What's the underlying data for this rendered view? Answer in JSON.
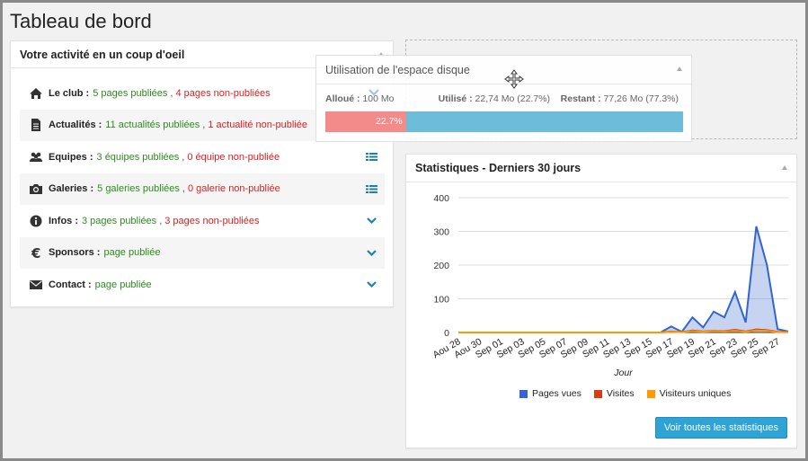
{
  "page": {
    "title": "Tableau de bord"
  },
  "activity": {
    "title": "Votre activité en un coup d'oeil",
    "rows": [
      {
        "icon": "home-icon",
        "label": "Le club :",
        "published": "5 pages publiées",
        "unpublished": "4 pages non-publiées",
        "action": ""
      },
      {
        "icon": "document-icon",
        "label": "Actualités :",
        "published": "11 actualités publiées",
        "unpublished": "1 actualité non-publiée",
        "action": ""
      },
      {
        "icon": "users-icon",
        "label": "Equipes :",
        "published": "3 équipes publiées",
        "unpublished": "0 équipe non-publiée",
        "action": "list-icon"
      },
      {
        "icon": "camera-icon",
        "label": "Galeries :",
        "published": "5 galeries publiées",
        "unpublished": "0 galerie non-publiée",
        "action": "list-icon"
      },
      {
        "icon": "info-icon",
        "label": "Infos :",
        "published": "3 pages publiées",
        "unpublished": "3 pages non-publiées",
        "action": "chevron-down-icon"
      },
      {
        "icon": "euro-icon",
        "label": "Sponsors :",
        "published": "page publiée",
        "unpublished": "",
        "action": "chevron-down-icon"
      },
      {
        "icon": "envelope-icon",
        "label": "Contact :",
        "published": "page publiée",
        "unpublished": "",
        "action": "chevron-down-icon"
      }
    ]
  },
  "disk": {
    "title": "Utilisation de l'espace disque",
    "allocated_label": "Alloué :",
    "allocated_value": "100 Mo",
    "used_label": "Utilisé :",
    "used_value": "22,74 Mo (22.7%)",
    "remaining_label": "Restant :",
    "remaining_value": "77,26 Mo (77.3%)",
    "percent_text": "22.7%",
    "used_fraction": 0.227
  },
  "stats": {
    "title": "Statistiques - Derniers 30 jours",
    "button_label": "Voir toutes les statistiques"
  },
  "colors": {
    "pages_vues": "#3366cc",
    "visites": "#dc3912",
    "visiteurs_uniques": "#ff9900",
    "green": "#2e8b1e",
    "red": "#e02020",
    "action_blue": "#1f7fb8"
  },
  "chart_data": {
    "type": "area",
    "xlabel": "Jour",
    "ylabel": "",
    "ylim": [
      0,
      400
    ],
    "yticks": [
      0,
      100,
      200,
      300,
      400
    ],
    "tick_labels": [
      "Aou 28",
      "Aou 30",
      "Sep 01",
      "Sep 03",
      "Sep 05",
      "Sep 07",
      "Sep 09",
      "Sep 11",
      "Sep 13",
      "Sep 15",
      "Sep 17",
      "Sep 19",
      "Sep 21",
      "Sep 23",
      "Sep 25",
      "Sep 27"
    ],
    "x": [
      "Aou 28",
      "Aou 29",
      "Aou 30",
      "Aou 31",
      "Sep 01",
      "Sep 02",
      "Sep 03",
      "Sep 04",
      "Sep 05",
      "Sep 06",
      "Sep 07",
      "Sep 08",
      "Sep 09",
      "Sep 10",
      "Sep 11",
      "Sep 12",
      "Sep 13",
      "Sep 14",
      "Sep 15",
      "Sep 16",
      "Sep 17",
      "Sep 18",
      "Sep 19",
      "Sep 20",
      "Sep 21",
      "Sep 22",
      "Sep 23",
      "Sep 24",
      "Sep 25",
      "Sep 26",
      "Sep 27",
      "Sep 28"
    ],
    "series": [
      {
        "name": "Pages vues",
        "values": [
          0,
          0,
          0,
          0,
          0,
          0,
          0,
          0,
          0,
          0,
          0,
          0,
          0,
          0,
          0,
          0,
          0,
          0,
          0,
          0,
          18,
          2,
          45,
          15,
          62,
          45,
          120,
          30,
          315,
          200,
          10,
          3
        ]
      },
      {
        "name": "Visites",
        "values": [
          0,
          0,
          0,
          0,
          0,
          0,
          0,
          0,
          0,
          0,
          0,
          0,
          0,
          0,
          0,
          0,
          0,
          0,
          0,
          0,
          3,
          1,
          6,
          3,
          5,
          4,
          8,
          3,
          9,
          7,
          2,
          1
        ]
      },
      {
        "name": "Visiteurs uniques",
        "values": [
          0,
          0,
          0,
          0,
          0,
          0,
          0,
          0,
          0,
          0,
          0,
          0,
          0,
          0,
          0,
          0,
          0,
          0,
          0,
          0,
          2,
          1,
          4,
          2,
          4,
          3,
          5,
          2,
          6,
          5,
          1,
          1
        ]
      }
    ],
    "legend": "bottom"
  }
}
